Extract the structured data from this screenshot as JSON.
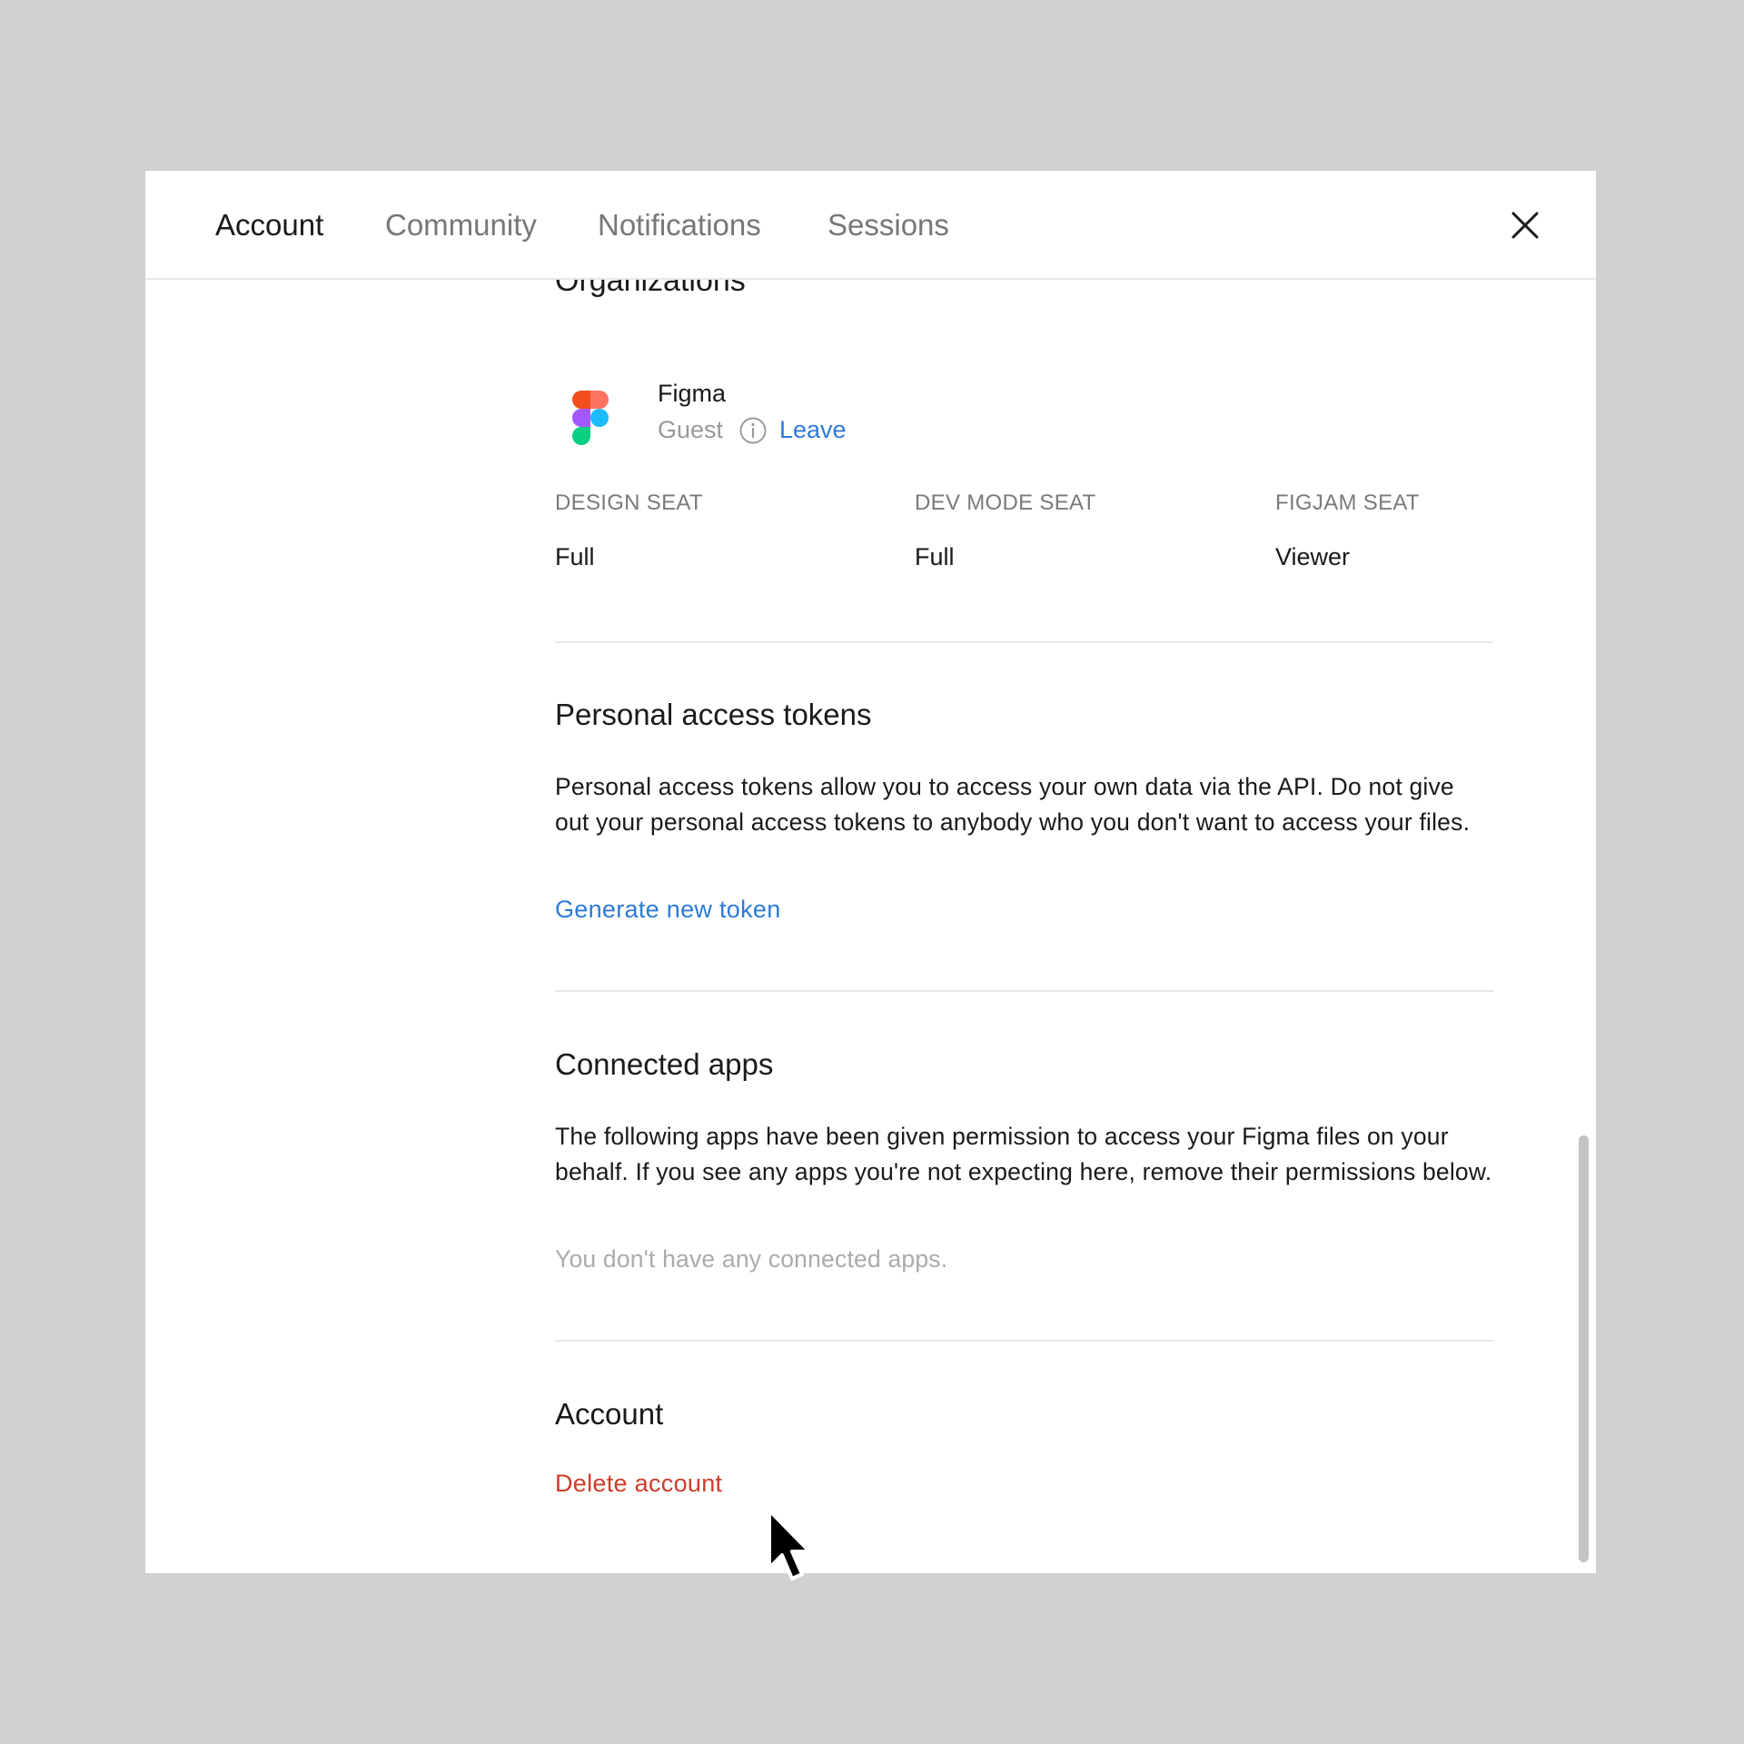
{
  "tabs": [
    {
      "label": "Account",
      "active": true
    },
    {
      "label": "Community",
      "active": false
    },
    {
      "label": "Notifications",
      "active": false
    },
    {
      "label": "Sessions",
      "active": false
    }
  ],
  "close_icon": "close-icon",
  "organizations": {
    "heading": "Organizations",
    "org": {
      "name": "Figma",
      "role": "Guest",
      "info_icon": "info-icon",
      "leave_label": "Leave",
      "logo": "figma-logo"
    },
    "seats": [
      {
        "label": "DESIGN SEAT",
        "value": "Full"
      },
      {
        "label": "DEV MODE SEAT",
        "value": "Full"
      },
      {
        "label": "FIGJAM SEAT",
        "value": "Viewer"
      }
    ]
  },
  "tokens": {
    "title": "Personal access tokens",
    "description": "Personal access tokens allow you to access your own data via the API. Do not give out your personal access tokens to anybody who you don't want to access your files.",
    "generate_label": "Generate new token"
  },
  "connected_apps": {
    "title": "Connected apps",
    "description": "The following apps have been given permission to access your Figma files on your behalf. If you see any apps you're not expecting here, remove their permissions below.",
    "empty_text": "You don't have any connected apps."
  },
  "account": {
    "title": "Account",
    "delete_label": "Delete account"
  },
  "colors": {
    "link": "#2e7bd6",
    "danger": "#cc3d2b",
    "backdrop": "#d1d1d1"
  }
}
